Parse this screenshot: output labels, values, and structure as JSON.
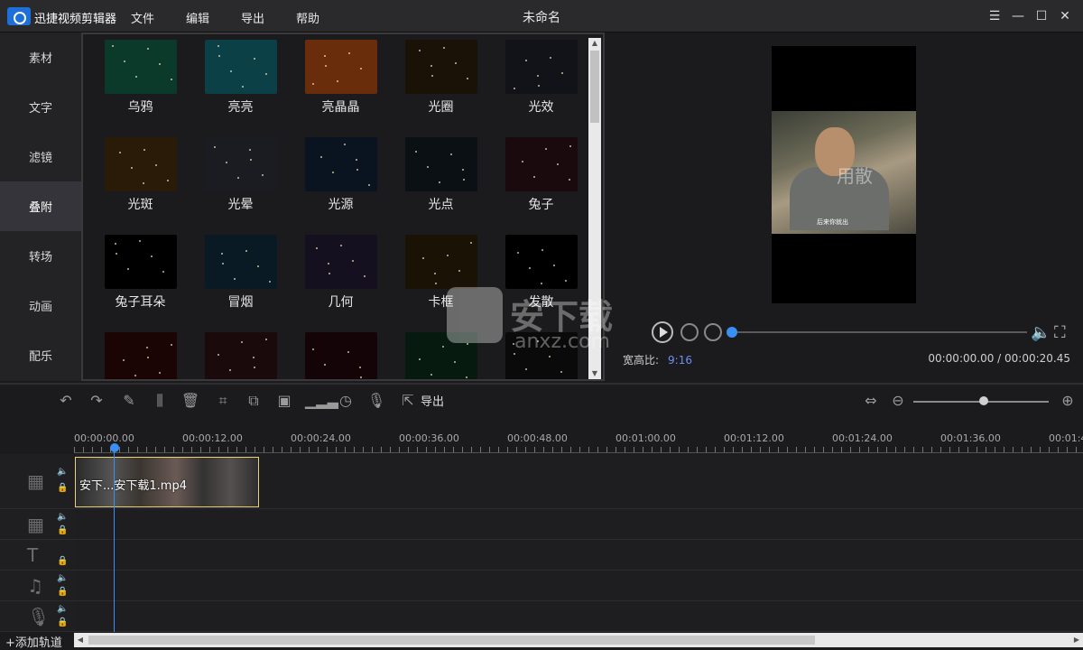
{
  "titlebar": {
    "app_name": "迅捷视频剪辑器",
    "window_title": "未命名",
    "menu": [
      "文件",
      "编辑",
      "导出",
      "帮助"
    ]
  },
  "leftnav": {
    "items": [
      "素材",
      "文字",
      "滤镜",
      "叠附",
      "转场",
      "动画",
      "配乐"
    ],
    "active": "叠附"
  },
  "library": {
    "items": [
      {
        "label": "乌鸦",
        "thumb": "#0b3a2a"
      },
      {
        "label": "亮亮",
        "thumb": "#0a4046"
      },
      {
        "label": "亮晶晶",
        "thumb": "#6a2d0c"
      },
      {
        "label": "光圈",
        "thumb": "#1a1206"
      },
      {
        "label": "光效",
        "thumb": "#111318"
      },
      {
        "label": "光斑",
        "thumb": "#2a1a08"
      },
      {
        "label": "光晕",
        "thumb": "#1a1c22"
      },
      {
        "label": "光源",
        "thumb": "#0a1420"
      },
      {
        "label": "光点",
        "thumb": "#0b1015"
      },
      {
        "label": "兔子",
        "thumb": "#1a0a0e"
      },
      {
        "label": "兔子耳朵",
        "thumb": "#000000"
      },
      {
        "label": "冒烟",
        "thumb": "#0a1a24"
      },
      {
        "label": "几何",
        "thumb": "#14101f"
      },
      {
        "label": "卡框",
        "thumb": "#1a1204"
      },
      {
        "label": "发散",
        "thumb": "#000000"
      },
      {
        "label": "",
        "thumb": "#1a0404"
      },
      {
        "label": "",
        "thumb": "#1a0a0c"
      },
      {
        "label": "",
        "thumb": "#140408"
      },
      {
        "label": "",
        "thumb": "#061a10"
      },
      {
        "label": "",
        "thumb": "#0a0a0a"
      }
    ]
  },
  "preview": {
    "subtitle": "后来你就出",
    "frame_caption": "用散",
    "ratio_label": "宽高比:",
    "ratio_value": "9:16",
    "timecode": "00:00:00.00 / 00:00:20.45",
    "progress": 0
  },
  "watermark": {
    "text": "安下载",
    "sub": "anxz.com"
  },
  "toolbar": {
    "export_label": "导出",
    "zoom": 0.5
  },
  "ruler": {
    "labels": [
      "00:00:00.00",
      "00:00:12.00",
      "00:00:24.00",
      "00:00:36.00",
      "00:00:48.00",
      "00:01:00.00",
      "00:01:12.00",
      "00:01:24.00",
      "00:01:36.00",
      "00:01:4"
    ]
  },
  "timeline": {
    "clip_label": "安下...安下载1.mp4",
    "add_track": "+添加轨道"
  },
  "colors": {
    "accent": "#3b8ef3",
    "ratio_value": "#6f8ff0",
    "clip_border": "#e9d27b"
  }
}
